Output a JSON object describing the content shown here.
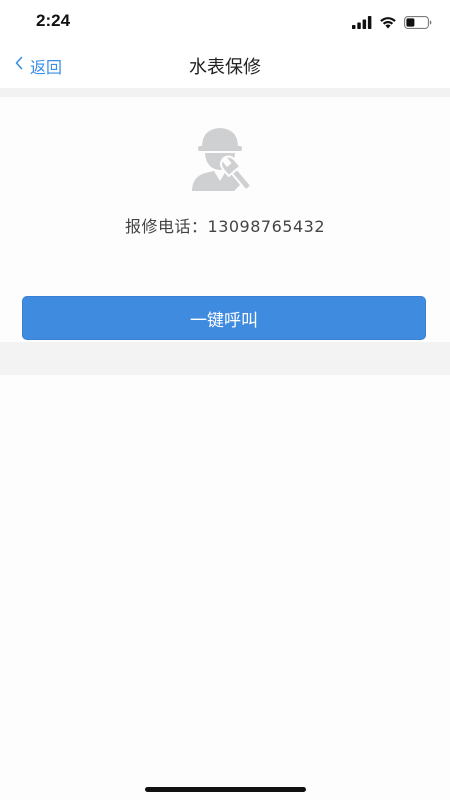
{
  "status_bar": {
    "time": "2:24",
    "icons": [
      "signal-icon",
      "wifi-icon",
      "battery-icon"
    ]
  },
  "nav": {
    "back_label": "返回",
    "title": "水表保修"
  },
  "repair": {
    "icon": "repair-worker-icon",
    "phone_label": "报修电话：",
    "phone_number": "13098765432",
    "call_button_label": "一键呼叫"
  },
  "colors": {
    "accent": "#3f8be0",
    "back_link": "#3a8ee6",
    "band": "#f2f2f2",
    "icon_gray": "#cfd0d2"
  }
}
